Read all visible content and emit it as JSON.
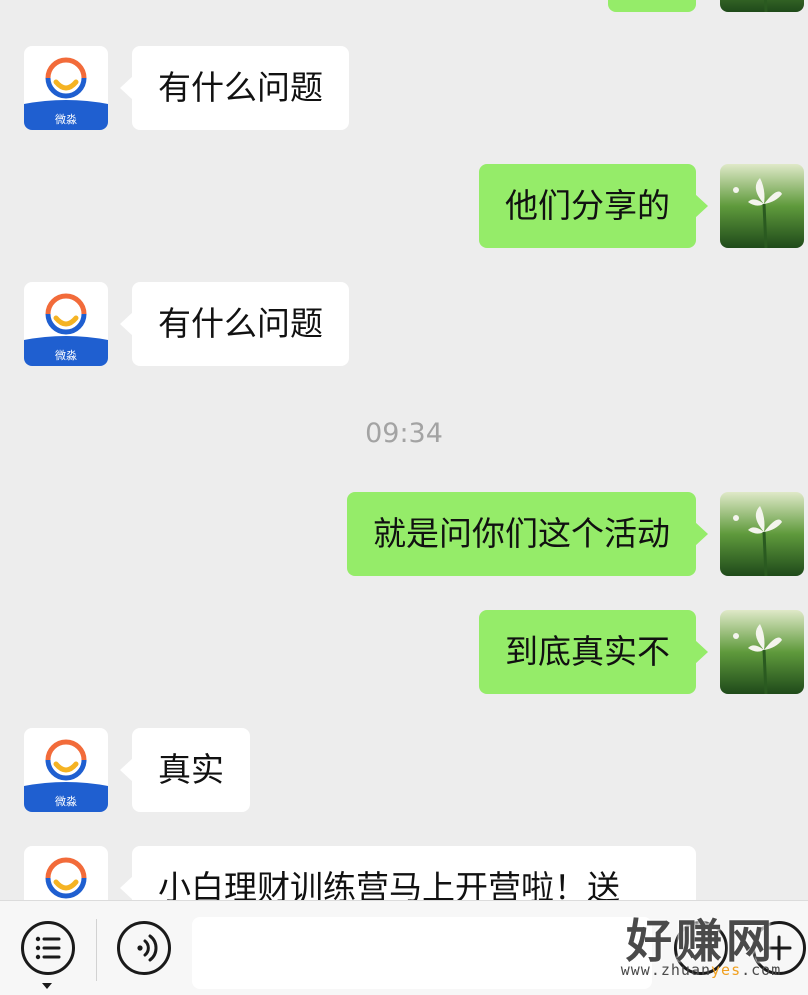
{
  "messages": [
    {
      "side": "right",
      "text": ""
    },
    {
      "side": "left",
      "text": "有什么问题"
    },
    {
      "side": "right",
      "text": "他们分享的"
    },
    {
      "side": "left",
      "text": "有什么问题"
    },
    {
      "side": "right",
      "text": "就是问你们这个活动"
    },
    {
      "side": "right",
      "text": "到底真实不"
    },
    {
      "side": "left",
      "text": "真实"
    },
    {
      "side": "left",
      "text": "小白理财训练营马上开营啦！送"
    }
  ],
  "timestamp": "09:34",
  "contact_avatar": {
    "label": "微淼",
    "colors": {
      "ring": "#f26b3a",
      "smile": "#f5b323",
      "base": "#1f5fd0"
    }
  },
  "toolbar": {
    "menu_icon": "list-menu-icon",
    "voice_icon": "voice-icon",
    "emoji_icon": "emoji-icon",
    "plus_icon": "plus-icon"
  },
  "watermark": {
    "title": "好赚网",
    "url_prefix": "www.zhuan",
    "url_highlight": "yes",
    "url_suffix": ".com"
  },
  "colors": {
    "background": "#ededed",
    "my_bubble": "#95ec69",
    "their_bubble": "#ffffff",
    "timestamp": "#a3a3a3"
  }
}
